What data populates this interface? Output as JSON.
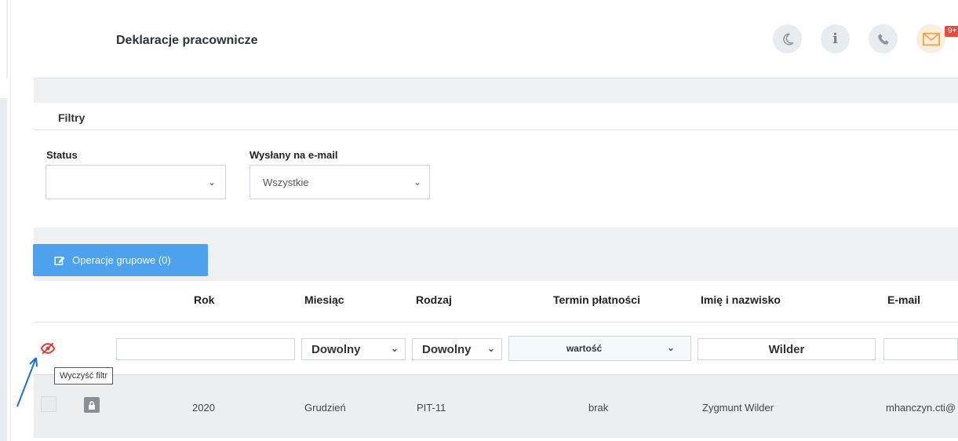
{
  "header": {
    "title": "Deklaracje pracownicze",
    "icons": [
      "moon-icon",
      "info-icon",
      "phone-icon",
      "mail-icon"
    ],
    "mail_badge": "9+"
  },
  "filters": {
    "title": "Filtry",
    "status_label": "Status",
    "status_value": "",
    "email_label": "Wysłany na e-mail",
    "email_value": "Wszystkie"
  },
  "toolbar": {
    "group_ops_label": "Operacje grupowe (0)"
  },
  "table": {
    "columns": [
      "Rok",
      "Miesiąc",
      "Rodzaj",
      "Termin płatności",
      "Imię i nazwisko",
      "E-mail"
    ],
    "filter_row": {
      "rok": "",
      "miesiac": "Dowolny",
      "rodzaj": "Dowolny",
      "termin": "wartość",
      "imie": "Wilder",
      "email": ""
    },
    "clear_filter_tooltip": "Wyczyść filtr",
    "rows": [
      {
        "rok": "2020",
        "miesiac": "Grudzień",
        "rodzaj": "PIT-11",
        "termin": "brak",
        "imie": "Zygmunt Wilder",
        "email": "mhanczyn.cti@"
      }
    ]
  },
  "colors": {
    "primary": "#4ea1ec",
    "badge": "#e74c3c",
    "clear_filter_icon": "#e53935",
    "arrow": "#1e6fd0"
  }
}
